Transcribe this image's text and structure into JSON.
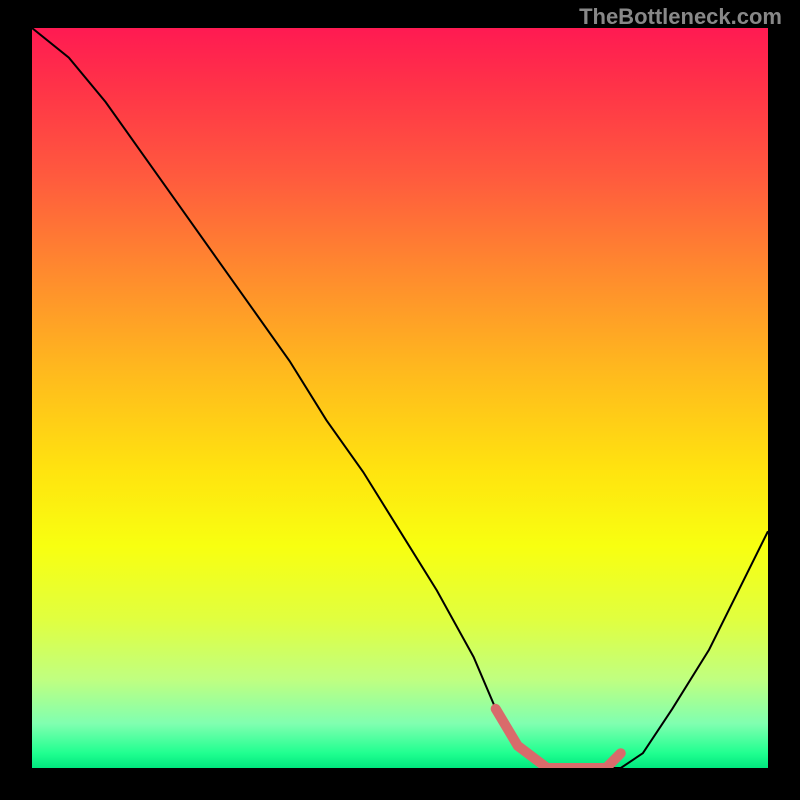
{
  "watermark": "TheBottleneck.com",
  "chart_data": {
    "type": "line",
    "title": "",
    "xlabel": "",
    "ylabel": "",
    "xlim": [
      0,
      100
    ],
    "ylim": [
      0,
      100
    ],
    "series": [
      {
        "name": "curve",
        "x": [
          0,
          5,
          10,
          15,
          20,
          25,
          30,
          35,
          40,
          45,
          50,
          55,
          60,
          63,
          66,
          70,
          74,
          78,
          80,
          83,
          87,
          92,
          96,
          100
        ],
        "y": [
          100,
          96,
          90,
          83,
          76,
          69,
          62,
          55,
          47,
          40,
          32,
          24,
          15,
          8,
          3,
          0,
          0,
          0,
          0,
          2,
          8,
          16,
          24,
          32
        ]
      },
      {
        "name": "highlight",
        "x": [
          63,
          66,
          70,
          74,
          78,
          80
        ],
        "y": [
          8,
          3,
          0,
          0,
          0,
          2
        ]
      }
    ],
    "gradient_stops": [
      {
        "pos": 0,
        "color": "#ff1a52"
      },
      {
        "pos": 20,
        "color": "#ff5a3e"
      },
      {
        "pos": 46,
        "color": "#ffb81e"
      },
      {
        "pos": 70,
        "color": "#f8ff10"
      },
      {
        "pos": 100,
        "color": "#00e77e"
      }
    ],
    "highlight_color": "#d96b6b"
  }
}
